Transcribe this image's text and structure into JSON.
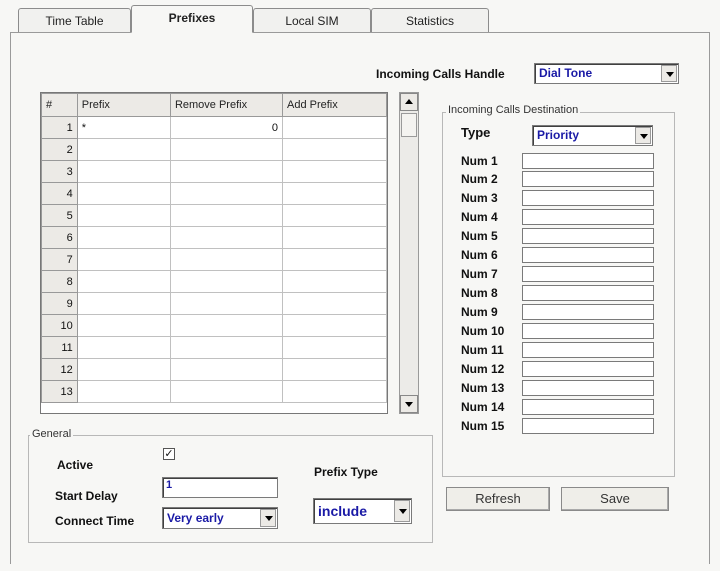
{
  "tabs": [
    {
      "label": "Time Table"
    },
    {
      "label": "Prefixes"
    },
    {
      "label": "Local SIM"
    },
    {
      "label": "Statistics"
    }
  ],
  "incoming_calls_handle": {
    "label": "Incoming Calls Handle",
    "value": "Dial Tone"
  },
  "grid": {
    "headers": [
      "#",
      "Prefix",
      "Remove Prefix",
      "Add Prefix"
    ],
    "rows": [
      {
        "n": "1",
        "prefix": "*",
        "remove": "0",
        "add": ""
      },
      {
        "n": "2",
        "prefix": "",
        "remove": "",
        "add": ""
      },
      {
        "n": "3",
        "prefix": "",
        "remove": "",
        "add": ""
      },
      {
        "n": "4",
        "prefix": "",
        "remove": "",
        "add": ""
      },
      {
        "n": "5",
        "prefix": "",
        "remove": "",
        "add": ""
      },
      {
        "n": "6",
        "prefix": "",
        "remove": "",
        "add": ""
      },
      {
        "n": "7",
        "prefix": "",
        "remove": "",
        "add": ""
      },
      {
        "n": "8",
        "prefix": "",
        "remove": "",
        "add": ""
      },
      {
        "n": "9",
        "prefix": "",
        "remove": "",
        "add": ""
      },
      {
        "n": "10",
        "prefix": "",
        "remove": "",
        "add": ""
      },
      {
        "n": "11",
        "prefix": "",
        "remove": "",
        "add": ""
      },
      {
        "n": "12",
        "prefix": "",
        "remove": "",
        "add": ""
      },
      {
        "n": "13",
        "prefix": "",
        "remove": "",
        "add": ""
      }
    ]
  },
  "destination": {
    "legend": "Incoming Calls Destination",
    "type_label": "Type",
    "type_value": "Priority",
    "nums": [
      "Num 1",
      "Num 2",
      "Num 3",
      "Num 4",
      "Num 5",
      "Num 6",
      "Num 7",
      "Num 8",
      "Num 9",
      "Num 10",
      "Num 11",
      "Num 12",
      "Num 13",
      "Num 14",
      "Num 15"
    ]
  },
  "general": {
    "legend": "General",
    "active_label": "Active",
    "active_checked": true,
    "start_delay_label": "Start Delay",
    "start_delay_value": "1",
    "connect_time_label": "Connect Time",
    "connect_time_value": "Very early",
    "prefix_type_label": "Prefix Type",
    "prefix_type_value": "include"
  },
  "buttons": {
    "refresh": "Refresh",
    "save": "Save"
  }
}
